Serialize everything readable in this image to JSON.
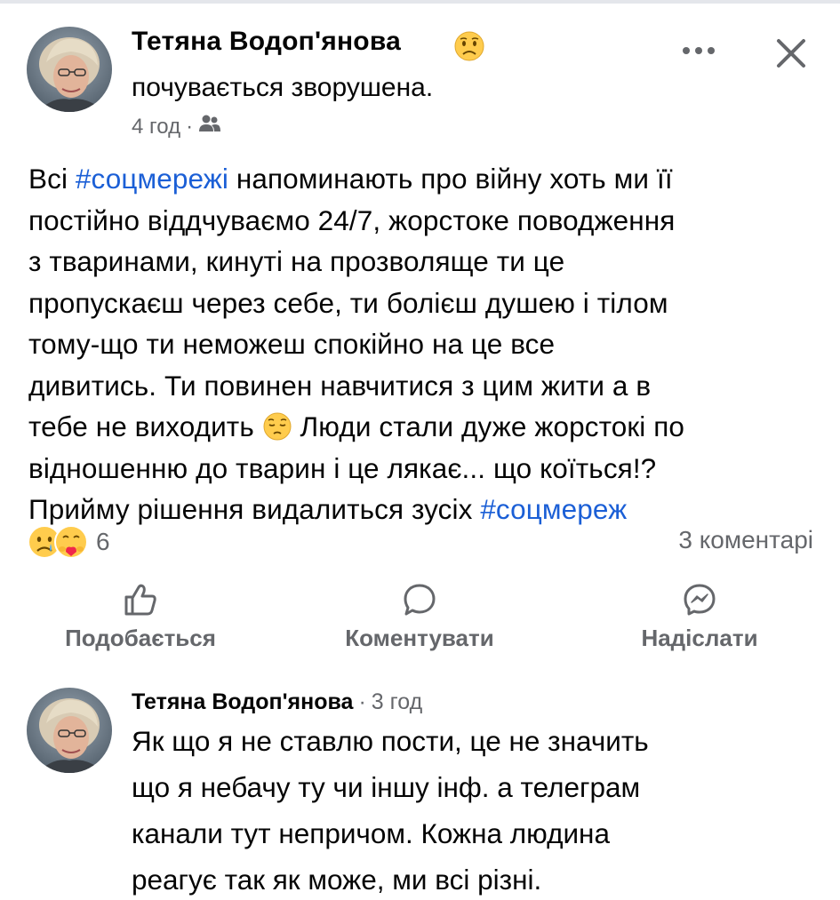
{
  "post": {
    "author": "Тетяна Водоп'янова",
    "feeling": "почувається зворушена.",
    "time": "4 год",
    "meta_separator": "·",
    "audience_icon": "friends-icon",
    "feeling_icon": "sad-face-emoji",
    "body_lines": [
      {
        "before": "Всі ",
        "hashtag": "#соцмережі",
        "after": " напоминають про війну хоть ми її"
      },
      {
        "text": "постійно віддчуваємо 24/7, жорстоке поводження"
      },
      {
        "text": "з тваринами, кинуті на прозволяще ти це"
      },
      {
        "text": "пропускаєш через себе, ти болієш душею і тілом"
      },
      {
        "text": "тому-що ти неможеш спокійно на це все"
      },
      {
        "text": "дивитись.  Ти повинен навчитися з цим жити а в"
      },
      {
        "before": "тебе не виходить ",
        "emoji": "pensive-face-emoji",
        "after": " Люди стали дуже жорстокі по"
      },
      {
        "text": "відношенню  до тварин і це лякає... що коїться!?"
      },
      {
        "before": "Прийму рішення видалиться зусіх ",
        "hashtag": "#соцмереж"
      }
    ]
  },
  "reactions": {
    "icons": [
      "sad-reaction-icon",
      "care-reaction-icon"
    ],
    "count": "6"
  },
  "comments_count": "3 коментарі",
  "actions": {
    "like": "Подобається",
    "comment": "Коментувати",
    "send": "Надіслати"
  },
  "comment": {
    "author": "Тетяна Водоп'янова",
    "separator": "·",
    "time": "3 год",
    "lines": [
      "Як що я не ставлю пости, це не значить",
      "що я небачу ту чи іншу інф. а телеграм",
      "канали тут непричом. Кожна людина",
      "реагує так як може, ми всі різні."
    ]
  },
  "colors": {
    "hashtag": "#1b5fd6",
    "secondary_text": "#65676b",
    "primary_text": "#050505"
  }
}
